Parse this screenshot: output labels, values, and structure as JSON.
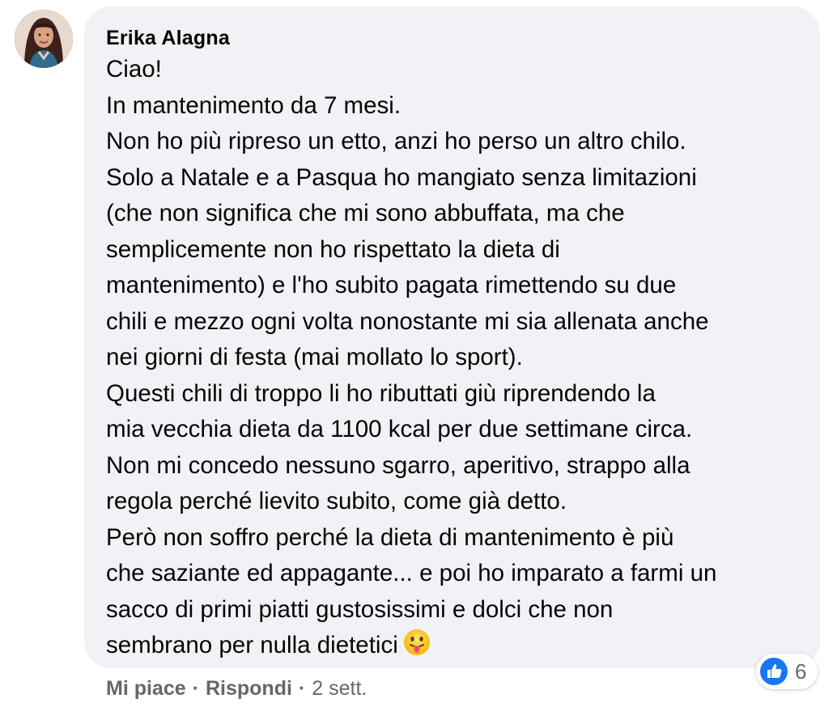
{
  "comment": {
    "author": "Erika Alagna",
    "lines": [
      "Ciao!",
      "In mantenimento da 7 mesi.",
      "Non ho più ripreso un etto, anzi ho perso un altro chilo.",
      "Solo a Natale e a Pasqua ho mangiato senza limitazioni",
      "(che non significa che mi sono abbuffata, ma che",
      "semplicemente non ho rispettato la dieta di",
      "mantenimento) e l'ho subito pagata rimettendo su due",
      "chili e mezzo ogni volta nonostante mi sia allenata anche",
      "nei giorni di festa (mai mollato lo sport).",
      "Questi chili di troppo li ho ributtati giù riprendendo la",
      "mia vecchia dieta da 1100 kcal per due settimane circa.",
      "Non mi concedo nessuno sgarro, aperitivo, strappo alla",
      "regola perché lievito subito, come già detto.",
      "Però non soffro perché la dieta di mantenimento è più",
      "che saziante ed appagante... e poi ho imparato a farmi un",
      "sacco di primi piatti gustosissimi e dolci che non",
      "sembrano per nulla dietetici"
    ],
    "trailing_emoji": "tongue-out-emoji"
  },
  "reactions": {
    "icon": "like-icon",
    "count": "6",
    "color": "#1877f2"
  },
  "actions": {
    "like_label": "Mi piace",
    "separator": "·",
    "reply_label": "Rispondi",
    "timestamp": "2 sett."
  },
  "colors": {
    "bubble": "#f0f2f5",
    "text": "#050505",
    "secondary": "#65676b"
  }
}
